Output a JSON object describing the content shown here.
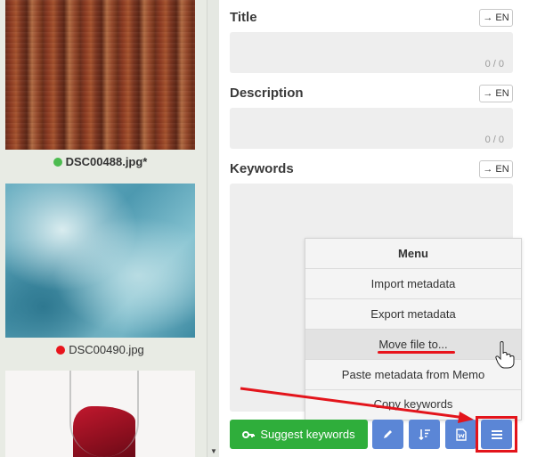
{
  "thumbnails": [
    {
      "filename": "DSC00488.jpg*",
      "status_color": "#4cbb4f",
      "bold": true
    },
    {
      "filename": "DSC00490.jpg",
      "status_color": "#e8141c",
      "bold": false
    },
    {
      "filename": "",
      "status_color": "",
      "bold": false
    }
  ],
  "fields": {
    "title": {
      "label": "Title",
      "lang": "→ EN",
      "counter": "0 / 0"
    },
    "description": {
      "label": "Description",
      "lang": "→ EN",
      "counter": "0 / 0"
    },
    "keywords": {
      "label": "Keywords",
      "lang": "→ EN"
    }
  },
  "menu": {
    "header": "Menu",
    "items": [
      "Import metadata",
      "Export metadata",
      "Move file to...",
      "Paste metadata from Memo",
      "Copy keywords"
    ],
    "highlighted_index": 2
  },
  "toolbar": {
    "suggest_label": "Suggest keywords",
    "suggest_icon": "key-icon",
    "buttons": [
      "pencil-icon",
      "sort-icon",
      "word-doc-icon",
      "hamburger-menu-icon"
    ],
    "accent_color": "#5b86d6",
    "suggest_color": "#2fae3b"
  },
  "annotation": {
    "color": "#e3141b"
  }
}
